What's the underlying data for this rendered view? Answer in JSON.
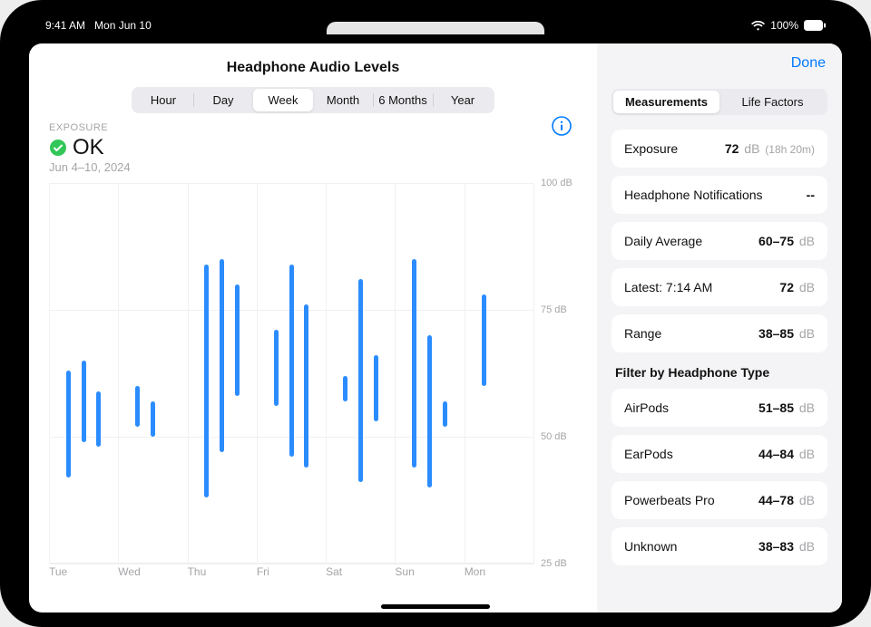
{
  "statusbar": {
    "time": "9:41 AM",
    "date": "Mon Jun 10",
    "battery_pct": "100%"
  },
  "header": {
    "title": "Headphone Audio Levels",
    "done": "Done"
  },
  "time_range": {
    "options": [
      "Hour",
      "Day",
      "Week",
      "Month",
      "6 Months",
      "Year"
    ],
    "selected_index": 2
  },
  "exposure": {
    "label": "EXPOSURE",
    "status_text": "OK",
    "date_range": "Jun 4–10, 2024"
  },
  "sidebar": {
    "tabs": [
      "Measurements",
      "Life Factors"
    ],
    "selected_tab": 0,
    "rows": [
      {
        "label": "Exposure",
        "value": "72",
        "unit": "dB",
        "sub": "(18h 20m)"
      },
      {
        "label": "Headphone Notifications",
        "value": "--",
        "unit": "",
        "sub": ""
      },
      {
        "label": "Daily Average",
        "value": "60–75",
        "unit": "dB",
        "sub": ""
      },
      {
        "label": "Latest: 7:14 AM",
        "value": "72",
        "unit": "dB",
        "sub": ""
      },
      {
        "label": "Range",
        "value": "38–85",
        "unit": "dB",
        "sub": ""
      }
    ],
    "filter_title": "Filter by Headphone Type",
    "filters": [
      {
        "label": "AirPods",
        "value": "51–85",
        "unit": "dB"
      },
      {
        "label": "EarPods",
        "value": "44–84",
        "unit": "dB"
      },
      {
        "label": "Powerbeats Pro",
        "value": "44–78",
        "unit": "dB"
      },
      {
        "label": "Unknown",
        "value": "38–83",
        "unit": "dB"
      }
    ]
  },
  "chart_data": {
    "type": "bar",
    "title": "Headphone Audio Levels",
    "xlabel": "",
    "ylabel": "dB",
    "ylim": [
      25,
      100
    ],
    "day_labels": [
      "Tue",
      "Wed",
      "Thu",
      "Fri",
      "Sat",
      "Sun",
      "Mon"
    ],
    "y_ticks": [
      25,
      50,
      75,
      100
    ],
    "y_tick_labels": [
      "25 dB",
      "50 dB",
      "75 dB",
      "100 dB"
    ],
    "bars": [
      {
        "day": 0,
        "slot": 0,
        "lo": 42,
        "hi": 63
      },
      {
        "day": 0,
        "slot": 1,
        "lo": 49,
        "hi": 65
      },
      {
        "day": 0,
        "slot": 2,
        "lo": 48,
        "hi": 59
      },
      {
        "day": 1,
        "slot": 0,
        "lo": 52,
        "hi": 60
      },
      {
        "day": 1,
        "slot": 1,
        "lo": 50,
        "hi": 57
      },
      {
        "day": 2,
        "slot": 0,
        "lo": 38,
        "hi": 84
      },
      {
        "day": 2,
        "slot": 1,
        "lo": 47,
        "hi": 85
      },
      {
        "day": 2,
        "slot": 2,
        "lo": 58,
        "hi": 80
      },
      {
        "day": 3,
        "slot": 0,
        "lo": 56,
        "hi": 71
      },
      {
        "day": 3,
        "slot": 1,
        "lo": 46,
        "hi": 84
      },
      {
        "day": 3,
        "slot": 2,
        "lo": 44,
        "hi": 76
      },
      {
        "day": 4,
        "slot": 0,
        "lo": 57,
        "hi": 62
      },
      {
        "day": 4,
        "slot": 1,
        "lo": 41,
        "hi": 81
      },
      {
        "day": 4,
        "slot": 2,
        "lo": 53,
        "hi": 66
      },
      {
        "day": 5,
        "slot": 0,
        "lo": 44,
        "hi": 85
      },
      {
        "day": 5,
        "slot": 1,
        "lo": 40,
        "hi": 70
      },
      {
        "day": 5,
        "slot": 2,
        "lo": 52,
        "hi": 57
      },
      {
        "day": 6,
        "slot": 0,
        "lo": 60,
        "hi": 78
      }
    ],
    "colors": {
      "bar": "#2b8cff"
    }
  }
}
